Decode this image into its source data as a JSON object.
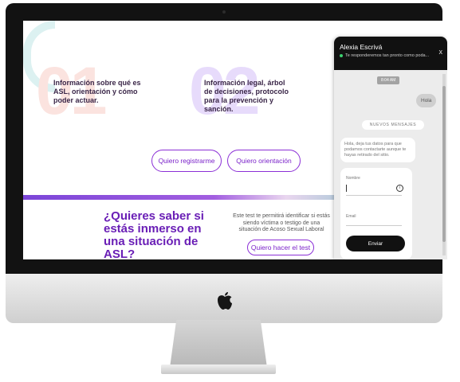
{
  "features": [
    {
      "number": "01",
      "text": "Información sobre qué es ASL, orientación y cómo poder actuar."
    },
    {
      "number": "02",
      "text": "Información legal, árbol de decisiones, protocolo para la prevención y sanción."
    }
  ],
  "cta": {
    "register": "Quiero registrarme",
    "orientation": "Quiero orientación"
  },
  "quiz": {
    "title": "¿Quieres saber si estás inmerso en una situación de ASL?",
    "description": "Este test te permitirá identificar si estás siendo víctima o testigo de una situación de Acoso Sexual Laboral",
    "button": "Quiero hacer el test"
  },
  "chat": {
    "agent_name": "Alexia Escrivá",
    "status": "Te responderemos tan pronto como poda...",
    "close": "x",
    "time": "8:04 AM",
    "user_message": "Hola",
    "new_messages": "NUEVOS MENSAJES",
    "prompt": "Hola, deja tus datos para que podamos contactarte aunque te hayas retirado del sitio.",
    "name_label": "Nombre",
    "email_placeholder": "Email",
    "send": "Enviar",
    "info_icon": "i"
  },
  "colors": {
    "accent": "#8b2fd6",
    "title": "#6a1fb6",
    "online": "#3bd16f"
  },
  "icons": [
    "apple-logo-icon",
    "close-icon",
    "info-icon",
    "status-dot-icon"
  ]
}
